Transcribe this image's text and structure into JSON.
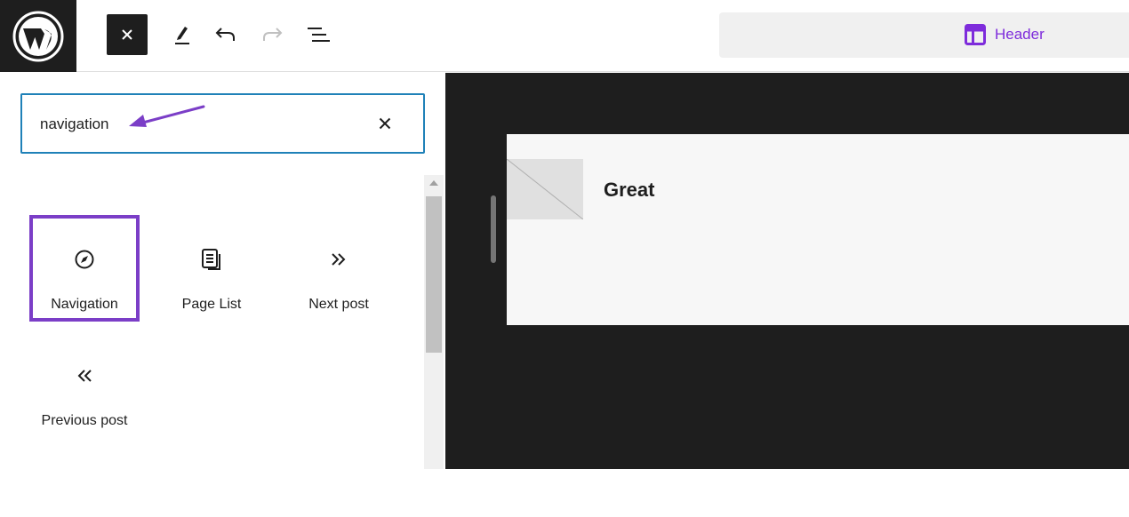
{
  "toolbar": {
    "logo_icon": "wordpress-logo-icon",
    "close_icon": "close-icon",
    "tools_icon": "pencil-icon",
    "undo_icon": "undo-icon",
    "redo_icon": "redo-icon",
    "outline_icon": "list-view-icon",
    "document": {
      "icon": "template-part-icon",
      "label": "Header"
    }
  },
  "search": {
    "value": "navigation",
    "clear_icon": "close-icon"
  },
  "results": [
    {
      "label": "Navigation",
      "icon": "compass-icon",
      "highlighted": true
    },
    {
      "label": "Page List",
      "icon": "page-list-icon",
      "highlighted": false
    },
    {
      "label": "Next post",
      "icon": "chevron-double-right-icon",
      "highlighted": false
    },
    {
      "label": "Previous post",
      "icon": "chevron-double-left-icon",
      "highlighted": false
    }
  ],
  "canvas": {
    "site_title": "Great"
  },
  "colors": {
    "accent": "#7e2cdb",
    "highlight": "#7b3ec7",
    "focus": "#1f81b8",
    "dark": "#1e1e1e"
  }
}
